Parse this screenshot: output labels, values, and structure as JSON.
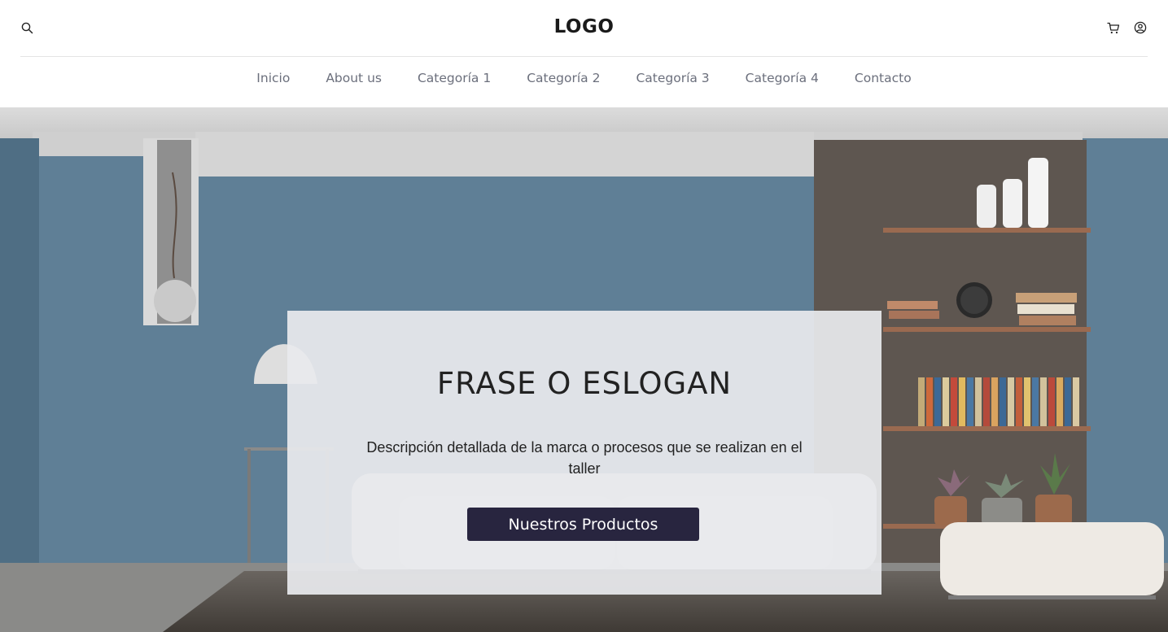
{
  "header": {
    "logo": "LOGO",
    "icons": [
      "search-icon",
      "cart-icon",
      "user-icon"
    ],
    "accent_color": "#3a8fd1"
  },
  "nav": {
    "items": [
      {
        "label": "Inicio"
      },
      {
        "label": "About us"
      },
      {
        "label": "Categoría 1"
      },
      {
        "label": "Categoría 2"
      },
      {
        "label": "Categoría 3"
      },
      {
        "label": "Categoría 4"
      },
      {
        "label": "Contacto"
      }
    ]
  },
  "hero": {
    "title": "FRASE O ESLOGAN",
    "description": "Descripción detallada de la marca o procesos que se realizan en el taller",
    "button_label": "Nuestros Productos",
    "button_color": "#28253f"
  }
}
